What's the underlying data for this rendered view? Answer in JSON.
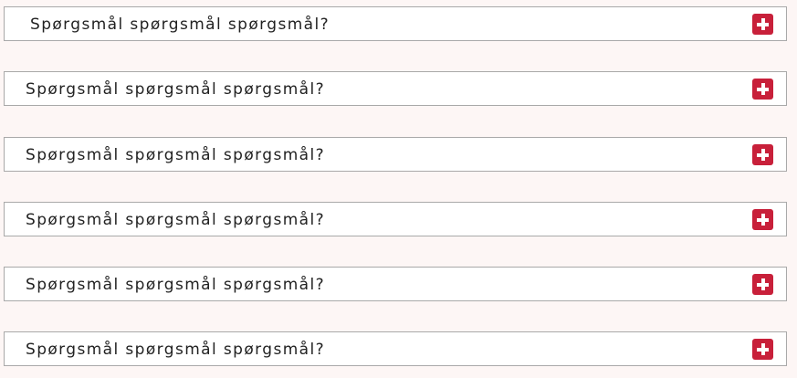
{
  "faq": {
    "items": [
      {
        "question": "Spørgsmål spørgsmål spørgsmål?",
        "toggle_icon": "plus-icon"
      },
      {
        "question": "Spørgsmål spørgsmål spørgsmål?",
        "toggle_icon": "plus-icon"
      },
      {
        "question": "Spørgsmål spørgsmål spørgsmål?",
        "toggle_icon": "plus-icon"
      },
      {
        "question": "Spørgsmål spørgsmål spørgsmål?",
        "toggle_icon": "plus-icon"
      },
      {
        "question": "Spørgsmål spørgsmål spørgsmål?",
        "toggle_icon": "plus-icon"
      },
      {
        "question": "Spørgsmål spørgsmål spørgsmål?",
        "toggle_icon": "plus-icon"
      }
    ]
  },
  "colors": {
    "background": "#fdf6f5",
    "item_background": "#ffffff",
    "item_border": "#a9a9a9",
    "text": "#222222",
    "accent": "#c8203a"
  }
}
